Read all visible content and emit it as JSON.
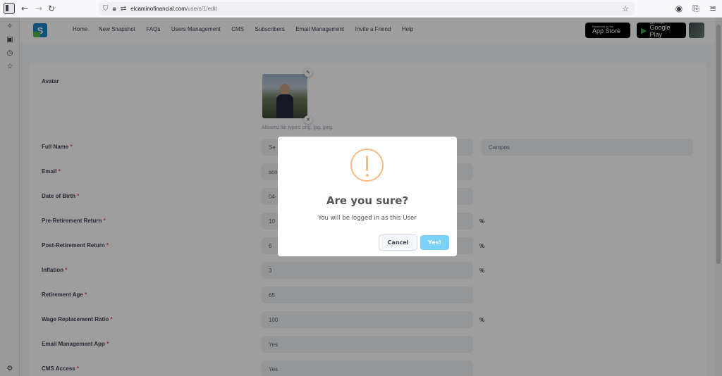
{
  "browser": {
    "url_host": "elcaminofinancial.com",
    "url_path": "/users/1/edit"
  },
  "nav": {
    "items": [
      "Home",
      "New Snapshot",
      "FAQs",
      "Users Management",
      "CMS",
      "Subscribers",
      "Email Management",
      "Invite a Friend",
      "Help"
    ]
  },
  "stores": {
    "app_store_small": "Download on the",
    "app_store_big": "App Store",
    "google_small": "GET IT ON",
    "google_big": "Google Play"
  },
  "form": {
    "avatar_label": "Avatar",
    "allowed_hint": "Allowed file types: png, jpg, jpeg.",
    "rows": [
      {
        "label": "Full Name",
        "value": "Se",
        "value2": "Campos"
      },
      {
        "label": "Email",
        "value": "sco"
      },
      {
        "label": "Date of Birth",
        "value": "04-"
      },
      {
        "label": "Pre-Retirement Return",
        "value": "10",
        "suffix": "%"
      },
      {
        "label": "Post-Retirement Return",
        "value": "6",
        "suffix": "%"
      },
      {
        "label": "Inflation",
        "value": "3",
        "suffix": "%"
      },
      {
        "label": "Retirement Age",
        "value": "65"
      },
      {
        "label": "Wage Replacement Ratio",
        "value": "100",
        "suffix": "%"
      },
      {
        "label": "Email Management App",
        "value": "Yes"
      },
      {
        "label": "CMS Access",
        "value": "Yes"
      }
    ],
    "required_mark": "*"
  },
  "modal": {
    "title": "Are you sure?",
    "text": "You will be logged in as this User",
    "cancel_label": "Cancel",
    "confirm_label": "Yes!"
  },
  "colors": {
    "warning": "#f8bb86",
    "confirm": "#7cd1f9",
    "required": "#f1416c"
  }
}
